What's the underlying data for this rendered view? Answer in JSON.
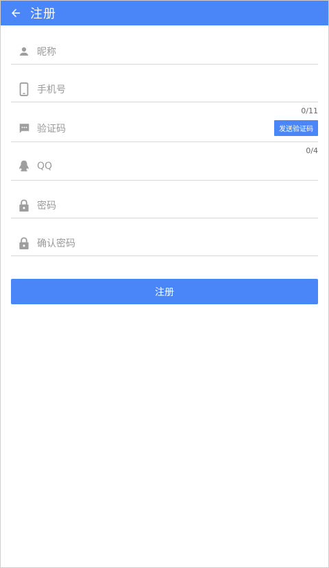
{
  "header": {
    "title": "注册"
  },
  "form": {
    "nickname": {
      "placeholder": "昵称",
      "icon": "person-icon"
    },
    "phone": {
      "placeholder": "手机号",
      "icon": "phone-icon",
      "counter": "0/11"
    },
    "code": {
      "placeholder": "验证码",
      "icon": "message-icon",
      "send_label": "发送验证码",
      "counter": "0/4"
    },
    "qq": {
      "placeholder": "QQ",
      "icon": "qq-icon"
    },
    "password": {
      "placeholder": "密码",
      "icon": "lock-icon"
    },
    "confirm_password": {
      "placeholder": "确认密码",
      "icon": "lock-icon"
    },
    "submit_label": "注册"
  },
  "colors": {
    "accent": "#4a86f7",
    "icon_gray": "#9e9e9e",
    "divider": "#d6d6d6"
  }
}
